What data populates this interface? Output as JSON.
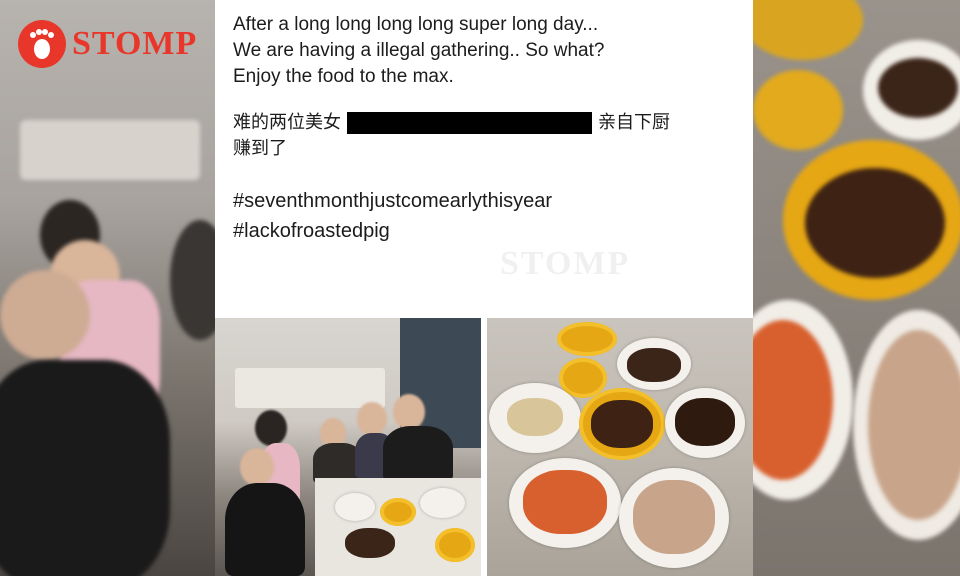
{
  "logo": {
    "text": "STOMP"
  },
  "watermark": {
    "text": "STOMP"
  },
  "post": {
    "line1": "After a long long long long super long day...",
    "line2": "We are having a illegal gathering.. So what?",
    "line3": "Enjoy the food to the max.",
    "cn_prefix": "难的两位美女",
    "cn_suffix": "亲自下厨",
    "cn_line2": "赚到了",
    "hashtag1": "#seventhmonthjustcomearlythisyear",
    "hashtag2": "#lackofroastedpig"
  },
  "colors": {
    "brand": "#e8372a",
    "redaction": "#000000",
    "bowl": "#e6a714"
  }
}
